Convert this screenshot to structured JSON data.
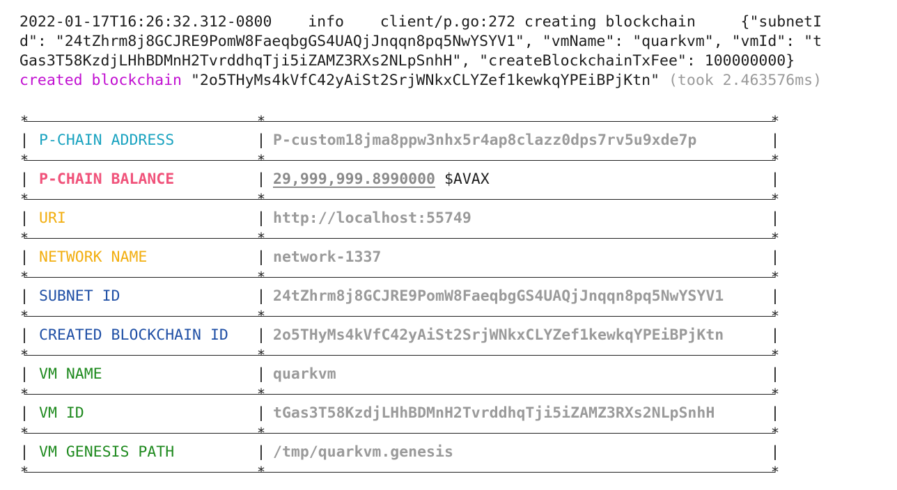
{
  "log": {
    "line1": "2022-01-17T16:26:32.312-0800    info    client/p.go:272 creating blockchain     {\"subnetI",
    "line2": "d\": \"24tZhrm8j8GCJRE9PomW8FaeqbgGS4UAQjJnqqn8pq5NwYSYV1\", \"vmName\": \"quarkvm\", \"vmId\": \"t",
    "line3": "Gas3T58KzdjLHhBDMnH2TvrddhqTji5iZAMZ3RXs2NLpSnhH\", \"createBlockchainTxFee\": 100000000}",
    "created_label": "created blockchain",
    "created_id": " \"2o5THyMs4kVfC42yAiSt2SrjWNkxCLYZef1kewkqYPEiBPjKtn\" ",
    "took": "(took 2.463576ms)"
  },
  "table": {
    "rows": [
      {
        "key": "P-CHAIN ADDRESS",
        "value": "P-custom18jma8ppw3nhx5r4ap8clazz0dps7rv5u9xde7p",
        "color": "#1aa3c0"
      },
      {
        "key": "P-CHAIN BALANCE",
        "value": "29,999,999.8990000",
        "unit": " $AVAX",
        "color": "#f0527a"
      },
      {
        "key": "URI",
        "value": "http://localhost:55749",
        "color": "#f2ae0f"
      },
      {
        "key": "NETWORK NAME",
        "value": "network-1337",
        "color": "#f2ae0f"
      },
      {
        "key": "SUBNET ID",
        "value": "24tZhrm8j8GCJRE9PomW8FaeqbgGS4UAQjJnqqn8pq5NwYSYV1",
        "color": "#1f4fa5"
      },
      {
        "key": "CREATED BLOCKCHAIN ID",
        "value": "2o5THyMs4kVfC42yAiSt2SrjWNkxCLYZef1kewkqYPEiBPjKtn",
        "color": "#1f4fa5"
      },
      {
        "key": "VM NAME",
        "value": "quarkvm",
        "color": "#1f8a1f"
      },
      {
        "key": "VM ID",
        "value": "tGas3T58KzdjLHhBDMnH2TvrddhqTji5iZAMZ3RXs2NLpSnhH",
        "color": "#1f8a1f"
      },
      {
        "key": "VM GENESIS PATH",
        "value": "/tmp/quarkvm.genesis",
        "color": "#1f8a1f"
      }
    ]
  }
}
